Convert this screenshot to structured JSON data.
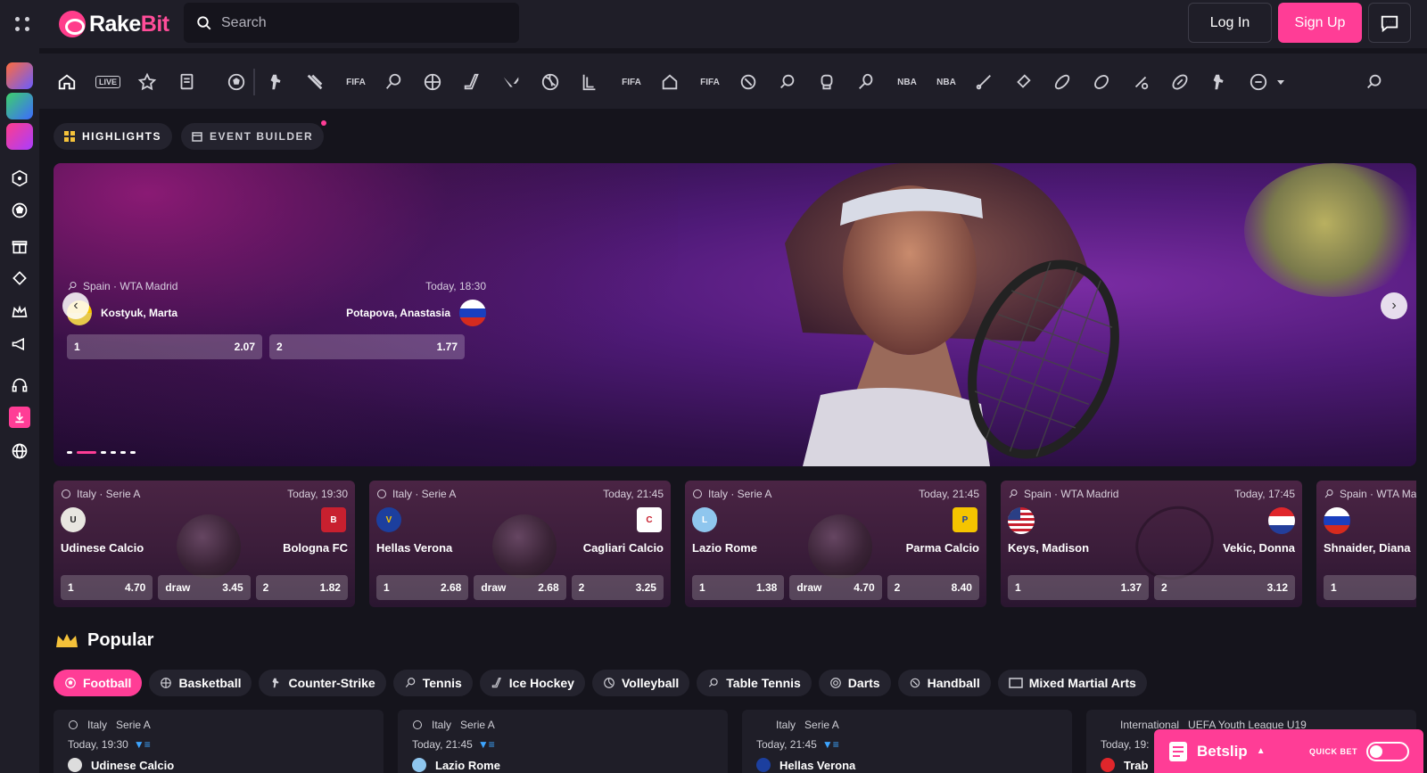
{
  "header": {
    "brand_rake": "Rake",
    "brand_bit": "Bit",
    "search_placeholder": "Search",
    "login_label": "Log In",
    "signup_label": "Sign Up"
  },
  "subtabs": [
    {
      "label": "HIGHLIGHTS"
    },
    {
      "label": "EVENT BUILDER"
    }
  ],
  "hero": {
    "league": "Spain · WTA Madrid",
    "time": "Today, 18:30",
    "home": "Kostyuk, Marta",
    "away": "Potapova, Anastasia",
    "odds": [
      {
        "label": "1",
        "value": "2.07"
      },
      {
        "label": "2",
        "value": "1.77"
      }
    ]
  },
  "cards": [
    {
      "league": "Italy · Serie A",
      "time": "Today, 19:30",
      "home": "Udinese Calcio",
      "away": "Bologna FC",
      "odds": [
        {
          "label": "1",
          "value": "4.70"
        },
        {
          "label": "draw",
          "value": "3.45"
        },
        {
          "label": "2",
          "value": "1.82"
        }
      ]
    },
    {
      "league": "Italy · Serie A",
      "time": "Today, 21:45",
      "home": "Hellas Verona",
      "away": "Cagliari Calcio",
      "odds": [
        {
          "label": "1",
          "value": "2.68"
        },
        {
          "label": "draw",
          "value": "2.68"
        },
        {
          "label": "2",
          "value": "3.25"
        }
      ]
    },
    {
      "league": "Italy · Serie A",
      "time": "Today, 21:45",
      "home": "Lazio Rome",
      "away": "Parma Calcio",
      "odds": [
        {
          "label": "1",
          "value": "1.38"
        },
        {
          "label": "draw",
          "value": "4.70"
        },
        {
          "label": "2",
          "value": "8.40"
        }
      ]
    },
    {
      "league": "Spain · WTA Madrid",
      "time": "Today, 17:45",
      "home": "Keys, Madison",
      "away": "Vekic, Donna",
      "odds": [
        {
          "label": "1",
          "value": "1.37"
        },
        {
          "label": "2",
          "value": "3.12"
        }
      ]
    },
    {
      "league": "Spain · WTA Ma",
      "time": "",
      "home": "Shnaider, Diana",
      "away": "",
      "odds": [
        {
          "label": "1",
          "value": ""
        }
      ]
    }
  ],
  "popular": {
    "title": "Popular",
    "filters": [
      "Football",
      "Basketball",
      "Counter-Strike",
      "Tennis",
      "Ice Hockey",
      "Volleyball",
      "Table Tennis",
      "Darts",
      "Handball",
      "Mixed Martial Arts"
    ]
  },
  "matches": [
    {
      "country": "Italy",
      "league": "Serie A",
      "time": "Today, 19:30",
      "team": "Udinese Calcio"
    },
    {
      "country": "Italy",
      "league": "Serie A",
      "time": "Today, 21:45",
      "team": "Lazio Rome"
    },
    {
      "country": "Italy",
      "league": "Serie A",
      "time": "Today, 21:45",
      "team": "Hellas Verona"
    },
    {
      "country": "International",
      "league": "UEFA Youth League U19",
      "time": "Today, 19:",
      "team": "Trab"
    }
  ],
  "betslip": {
    "label": "Betslip",
    "quick_bet": "QUICK BET"
  },
  "sport_icon_labels": {
    "live": "LIVE",
    "fifa": "FIFA"
  },
  "colors": {
    "accent": "#ff3d96",
    "panel": "#1f1e28",
    "background": "#15141c"
  }
}
